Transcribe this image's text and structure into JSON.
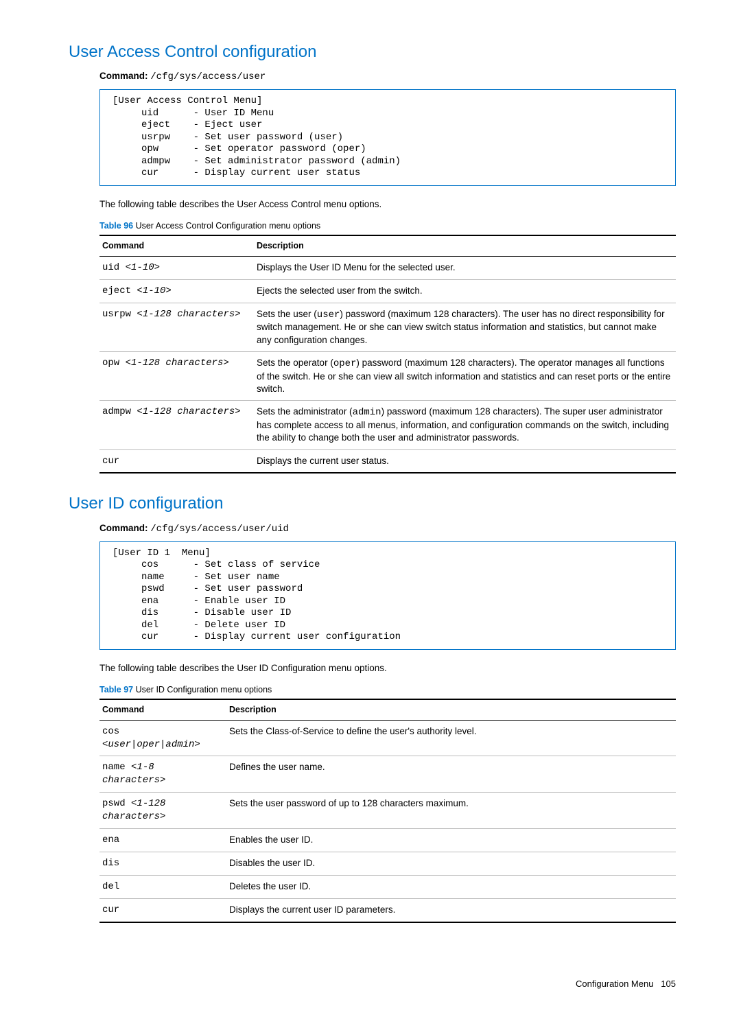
{
  "section1": {
    "heading": "User Access Control configuration",
    "command_label": "Command:",
    "command_path": "/cfg/sys/access/user",
    "menu_text": "[User Access Control Menu]\n     uid      - User ID Menu\n     eject    - Eject user\n     usrpw    - Set user password (user)\n     opw      - Set operator password (oper)\n     admpw    - Set administrator password (admin)\n     cur      - Display current user status",
    "body": "The following table describes the User Access Control menu options.",
    "table_label_prefix": "Table 96",
    "table_label_rest": " User Access Control Configuration menu options",
    "col1": "Command",
    "col2": "Description",
    "rows": [
      {
        "cmd": "uid ",
        "param": "<1-10>",
        "descHTML": "Displays the User ID Menu for the selected user."
      },
      {
        "cmd": "eject ",
        "param": "<1-10>",
        "descHTML": "Ejects the selected user from the switch."
      },
      {
        "cmd": "usrpw ",
        "param": "<1-128 characters>",
        "descHTML": "Sets the user (<span class=\"inline-mono\">user</span>) password (maximum 128 characters). The user has no direct responsibility for switch management. He or she can view switch status information and statistics, but cannot make any configuration changes."
      },
      {
        "cmd": "opw ",
        "param": "<1-128 characters>",
        "descHTML": "Sets the operator (<span class=\"inline-mono\">oper</span>)  password (maximum 128 characters). The operator manages all functions of the switch. He or she can view all switch information and statistics and can reset ports or the entire switch."
      },
      {
        "cmd": "admpw ",
        "param": "<1-128 characters>",
        "descHTML": "Sets the administrator (<span class=\"inline-mono\">admin</span>) password (maximum 128 characters). The super user administrator has complete access to all menus, information, and configuration commands on the switch, including the ability to change both the user and administrator passwords."
      },
      {
        "cmd": "cur",
        "param": "",
        "descHTML": "Displays the current user status."
      }
    ]
  },
  "section2": {
    "heading": "User ID configuration",
    "command_label": "Command:",
    "command_path": "/cfg/sys/access/user/uid",
    "menu_text": "[User ID 1  Menu]\n     cos      - Set class of service\n     name     - Set user name\n     pswd     - Set user password\n     ena      - Enable user ID\n     dis      - Disable user ID\n     del      - Delete user ID\n     cur      - Display current user configuration",
    "body": "The following table describes the User ID Configuration menu options.",
    "table_label_prefix": "Table 97",
    "table_label_rest": " User ID Configuration menu options",
    "col1": "Command",
    "col2": "Description",
    "rows": [
      {
        "cmd": "cos\n",
        "param": "<user|oper|admin>",
        "descHTML": "Sets the Class-of-Service to define the user's authority level."
      },
      {
        "cmd": "name ",
        "param": "<1-8 characters>",
        "descHTML": "Defines the user name."
      },
      {
        "cmd": "pswd ",
        "param": "<1-128 characters>",
        "descHTML": "Sets the user password of up to 128 characters maximum."
      },
      {
        "cmd": "ena",
        "param": "",
        "descHTML": "Enables the user ID."
      },
      {
        "cmd": "dis",
        "param": "",
        "descHTML": "Disables the user ID."
      },
      {
        "cmd": "del",
        "param": "",
        "descHTML": "Deletes the user ID."
      },
      {
        "cmd": "cur",
        "param": "",
        "descHTML": "Displays the current user ID parameters."
      }
    ]
  },
  "footer": {
    "section": "Configuration Menu",
    "page": "105"
  }
}
